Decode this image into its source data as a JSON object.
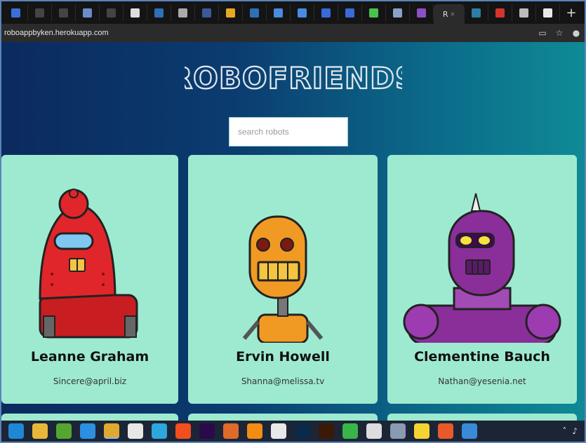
{
  "browser": {
    "url": "roboappbyken.herokuapp.com",
    "active_tab_label": "R",
    "tabs": [
      {
        "icon": "refresh-favicon-icon",
        "color": "#3b6fd8"
      },
      {
        "icon": "blank-favicon-icon",
        "color": "#444"
      },
      {
        "icon": "blank-favicon-icon",
        "color": "#444"
      },
      {
        "icon": "app-favicon-icon",
        "color": "#6b8cc9"
      },
      {
        "icon": "blank-favicon-icon",
        "color": "#444"
      },
      {
        "icon": "github-favicon-icon",
        "color": "#dddddd"
      },
      {
        "icon": "codepen-favicon-icon",
        "color": "#2e6fb5"
      },
      {
        "icon": "apple-favicon-icon",
        "color": "#aaaaaa"
      },
      {
        "icon": "facebook-favicon-icon",
        "color": "#3b5998"
      },
      {
        "icon": "yellow-favicon-icon",
        "color": "#e7a825"
      },
      {
        "icon": "codepen-favicon-icon",
        "color": "#2e6fb5"
      },
      {
        "icon": "filter-favicon-icon",
        "color": "#4a8ae0"
      },
      {
        "icon": "filter-favicon-icon",
        "color": "#4a8ae0"
      },
      {
        "icon": "circle-favicon-icon",
        "color": "#3c69d8"
      },
      {
        "icon": "circle-favicon-icon",
        "color": "#3c69d8"
      },
      {
        "icon": "green-dot-favicon-icon",
        "color": "#48c24e"
      },
      {
        "icon": "link-favicon-icon",
        "color": "#8aa0c8"
      },
      {
        "icon": "purple-favicon-icon",
        "color": "#8c4fc6"
      }
    ],
    "right_tabs": [
      {
        "icon": "globe-favicon-icon",
        "color": "#2d7ea6"
      },
      {
        "icon": "red-favicon-icon",
        "color": "#d3342b"
      },
      {
        "icon": "grid-favicon-icon",
        "color": "#bbbbbb"
      },
      {
        "icon": "chrome-favicon-icon",
        "color": "#e8e8e8"
      }
    ],
    "new_tab": "+"
  },
  "app": {
    "title": "ROBOFRIENDS",
    "search_placeholder": "search robots"
  },
  "robots": [
    {
      "name": "Leanne Graham",
      "email": "Sincere@april.biz",
      "color": "#e0262a"
    },
    {
      "name": "Ervin Howell",
      "email": "Shanna@melissa.tv",
      "color": "#f09a24"
    },
    {
      "name": "Clementine Bauch",
      "email": "Nathan@yesenia.net",
      "color": "#8a2e9a"
    }
  ],
  "colors": {
    "card_bg": "#9eead1",
    "title_stroke": "#dfe8ee",
    "gradient_left": "#0b2a5e",
    "gradient_right": "#0f8a96"
  },
  "taskbar": {
    "apps": [
      {
        "icon": "edge-icon",
        "color": "#1e88d6"
      },
      {
        "icon": "file-explorer-icon",
        "color": "#e8b73a"
      },
      {
        "icon": "utorrent-icon",
        "color": "#55a630"
      },
      {
        "icon": "vscode-icon",
        "color": "#2d8fe0"
      },
      {
        "icon": "chrome-icon",
        "color": "#e0a82e"
      },
      {
        "icon": "mail-icon",
        "color": "#e6e6e6"
      },
      {
        "icon": "telegram-icon",
        "color": "#2ea6de"
      },
      {
        "icon": "figma-icon",
        "color": "#f24e1e"
      },
      {
        "icon": "premiere-icon",
        "color": "#2a0a4a"
      },
      {
        "icon": "basketball-icon",
        "color": "#e06a2a"
      },
      {
        "icon": "vlc-icon",
        "color": "#f28c12"
      },
      {
        "icon": "itunes-icon",
        "color": "#e8e8e8"
      },
      {
        "icon": "photoshop-icon",
        "color": "#0b2a4a"
      },
      {
        "icon": "illustrator-icon",
        "color": "#3a1a06"
      },
      {
        "icon": "green-ring-icon",
        "color": "#39b54a"
      },
      {
        "icon": "obs-icon",
        "color": "#dddddd"
      },
      {
        "icon": "drive-icon",
        "color": "#8a9ab0"
      },
      {
        "icon": "sticky-notes-icon",
        "color": "#f5d431"
      },
      {
        "icon": "upload-icon",
        "color": "#e85a2a"
      },
      {
        "icon": "globe-icon",
        "color": "#3b8ad8"
      }
    ]
  }
}
